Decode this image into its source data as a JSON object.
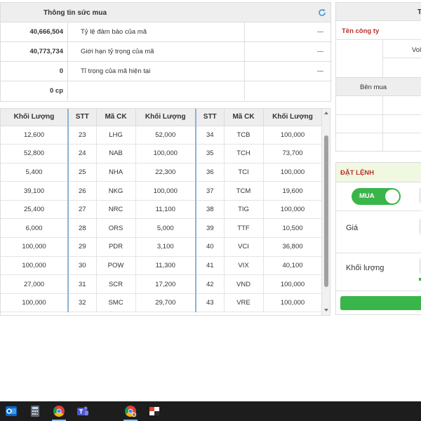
{
  "buying_power": {
    "title": "Thông tin sức mua",
    "rows": [
      {
        "value": "40,666,504",
        "label": "Tỷ lệ đảm bảo của mã",
        "extra": "---"
      },
      {
        "value": "40,773,734",
        "label": "Giới hạn tỷ trọng của mã",
        "extra": "---"
      },
      {
        "value": "0",
        "label": "Tỉ trọng của mã hiện tại",
        "extra": "---"
      },
      {
        "value": "0 cp",
        "label": "",
        "extra": ""
      }
    ]
  },
  "stock_table": {
    "headers": [
      "Khối Lượng",
      "STT",
      "Mã CK",
      "Khối Lượng",
      "STT",
      "Mã CK",
      "Khối Lượng"
    ],
    "rows": [
      [
        "12,600",
        "23",
        "LHG",
        "52,000",
        "34",
        "TCB",
        "100,000"
      ],
      [
        "52,800",
        "24",
        "NAB",
        "100,000",
        "35",
        "TCH",
        "73,700"
      ],
      [
        "5,400",
        "25",
        "NHA",
        "22,300",
        "36",
        "TCI",
        "100,000"
      ],
      [
        "39,100",
        "26",
        "NKG",
        "100,000",
        "37",
        "TCM",
        "19,600"
      ],
      [
        "25,400",
        "27",
        "NRC",
        "11,100",
        "38",
        "TIG",
        "100,000"
      ],
      [
        "6,000",
        "28",
        "ORS",
        "5,000",
        "39",
        "TTF",
        "10,500"
      ],
      [
        "100,000",
        "29",
        "PDR",
        "3,100",
        "40",
        "VCI",
        "36,800"
      ],
      [
        "100,000",
        "30",
        "POW",
        "11,300",
        "41",
        "VIX",
        "40,100"
      ],
      [
        "27,000",
        "31",
        "SCR",
        "17,200",
        "42",
        "VND",
        "100,000"
      ],
      [
        "100,000",
        "32",
        "SMC",
        "29,700",
        "43",
        "VRE",
        "100,000"
      ]
    ]
  },
  "right_panel": {
    "top_label": "T",
    "company_label": "Tên công ty",
    "vol_label": "Vol",
    "bid_label": "Bên mua"
  },
  "order": {
    "title": "ĐẶT LỆNH",
    "toggle_label": "MUA",
    "price_label": "Giá",
    "qty_label": "Khối lượng"
  },
  "colors": {
    "accent_green": "#3ab54a",
    "accent_red": "#b8322b",
    "header_gray": "#eeeeee",
    "column_separator": "#8ab4d8"
  },
  "taskbar": {
    "icons": [
      "outlook-icon",
      "calculator-icon",
      "chrome-icon",
      "teams-icon",
      "chrome-profile-icon",
      "app-icon"
    ]
  }
}
